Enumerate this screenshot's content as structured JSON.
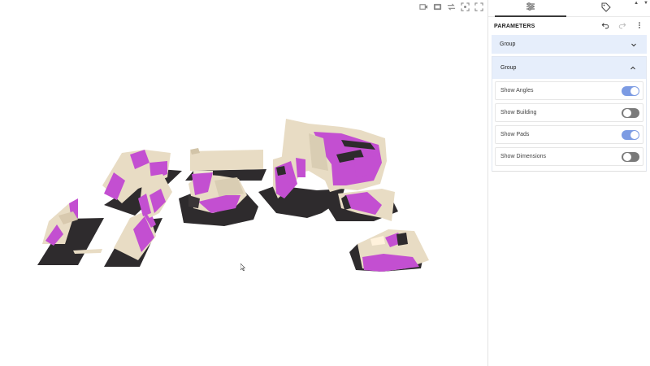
{
  "viewport": {
    "toolbar_icons": [
      "video-icon",
      "ar-icon",
      "swap-icon",
      "focus-icon",
      "fullscreen-icon"
    ]
  },
  "panel": {
    "tabs": [
      {
        "icon": "sliders-icon",
        "active": true
      },
      {
        "icon": "tag-icon",
        "active": false
      }
    ],
    "title": "PARAMETERS",
    "groups": [
      {
        "label": "Group",
        "expanded": false
      },
      {
        "label": "Group",
        "expanded": true,
        "params": [
          {
            "label": "Show Angles",
            "value": true
          },
          {
            "label": "Show Building",
            "value": false
          },
          {
            "label": "Show Pads",
            "value": true
          },
          {
            "label": "Show Dimensions",
            "value": false
          }
        ]
      }
    ]
  },
  "colors": {
    "accent": "#7c9be3",
    "group_bg": "#e6eefb",
    "toggle_off": "#7a7a7a",
    "ramp_magenta": "#c34fd1",
    "ramp_beige": "#e8dcc4",
    "pad_dark": "#2e2b2d"
  }
}
